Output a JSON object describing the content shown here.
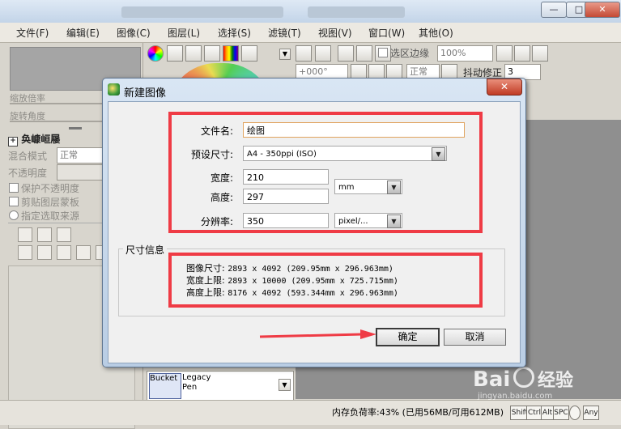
{
  "menu": [
    "文件(F)",
    "编辑(E)",
    "图像(C)",
    "图层(L)",
    "选择(S)",
    "滤镜(T)",
    "视图(V)",
    "窗口(W)",
    "其他(O)"
  ],
  "window_buttons": {
    "minimize": "—",
    "maximize": "□",
    "close": "✕"
  },
  "left_panel": {
    "zoom_label": "缩放倍率",
    "rotate_label": "旋转角度",
    "layer_header": "奂嵻峘屦",
    "blend_label": "混合模式",
    "blend_value": "正常",
    "opacity_label": "不透明度",
    "protect_opacity": "保护不透明度",
    "clip_mask": "剪贴图层蒙板",
    "select_source": "指定选取来源"
  },
  "toolbar": {
    "select_edge_label": "选区边缘",
    "zoom_value": "100%",
    "angle_value": "+000°",
    "mode_value": "正常",
    "stabilizer_label": "抖动修正",
    "stabilizer_value": "3"
  },
  "brush": {
    "tool1": "Bucket",
    "tool2": "Legacy",
    "tool2b": "Pen"
  },
  "status": {
    "memory": "内存负荷率:43% (已用56MB/可用612MB)",
    "keys": [
      "Shift",
      "Ctrl",
      "Alt",
      "SPC",
      "Any"
    ]
  },
  "dialog": {
    "title": "新建图像",
    "close_label": "✕",
    "filename_label": "文件名:",
    "filename_value": "绘图",
    "preset_label": "预设尺寸:",
    "preset_value": "A4 - 350ppi (ISO)",
    "width_label": "宽度:",
    "width_value": "210",
    "height_label": "高度:",
    "height_value": "297",
    "unit_value": "mm",
    "resolution_label": "分辨率:",
    "resolution_value": "350",
    "res_unit_value": "pixel/...",
    "size_info_header": "尺寸信息",
    "info": [
      {
        "label": "图像尺寸:",
        "value": "2893 x 4092 (209.95mm x 296.963mm)"
      },
      {
        "label": "宽度上限:",
        "value": "2893 x 10000 (209.95mm x 725.715mm)"
      },
      {
        "label": "高度上限:",
        "value": "8176 x 4092 (593.344mm x 296.963mm)"
      }
    ],
    "ok_label": "确定",
    "cancel_label": "取消"
  },
  "watermark": {
    "brand": "Bai",
    "brand2": "经验",
    "url": "jingyan.baidu.com"
  },
  "colors": {
    "highlight": "#ef3b45",
    "dialog_bg": "#f0f0f0",
    "canvas_bg": "#8f8f8f"
  }
}
